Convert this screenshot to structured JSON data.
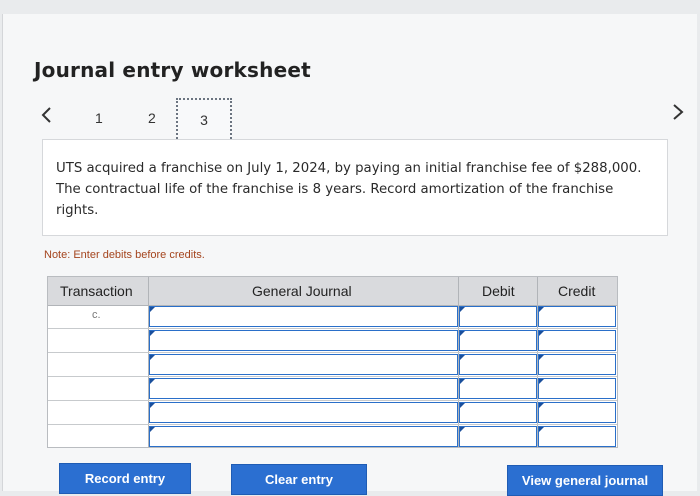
{
  "header": {
    "title": "Journal entry worksheet"
  },
  "pager": {
    "prev_icon": "chevron-left-icon",
    "next_icon": "chevron-right-icon",
    "pages": [
      "1",
      "2",
      "3"
    ],
    "active_page": "3"
  },
  "question": {
    "text": "UTS acquired a franchise on July 1, 2024, by paying an initial franchise fee of $288,000. The contractual life of the franchise is 8 years. Record amortization of the franchise rights."
  },
  "note": "Note: Enter debits before credits.",
  "journal": {
    "headers": {
      "transaction": "Transaction",
      "general_journal": "General Journal",
      "debit": "Debit",
      "credit": "Credit"
    },
    "rows": [
      {
        "transaction": "c.",
        "account": "",
        "debit": "",
        "credit": ""
      },
      {
        "transaction": "",
        "account": "",
        "debit": "",
        "credit": ""
      },
      {
        "transaction": "",
        "account": "",
        "debit": "",
        "credit": ""
      },
      {
        "transaction": "",
        "account": "",
        "debit": "",
        "credit": ""
      },
      {
        "transaction": "",
        "account": "",
        "debit": "",
        "credit": ""
      },
      {
        "transaction": "",
        "account": "",
        "debit": "",
        "credit": ""
      }
    ]
  },
  "buttons": {
    "record": "Record entry",
    "clear": "Clear entry",
    "view": "View general journal"
  },
  "colors": {
    "button_blue": "#2b6fd1",
    "input_border": "#2a6fc9",
    "note_text": "#a4441d",
    "header_gray": "#d9dadd"
  }
}
